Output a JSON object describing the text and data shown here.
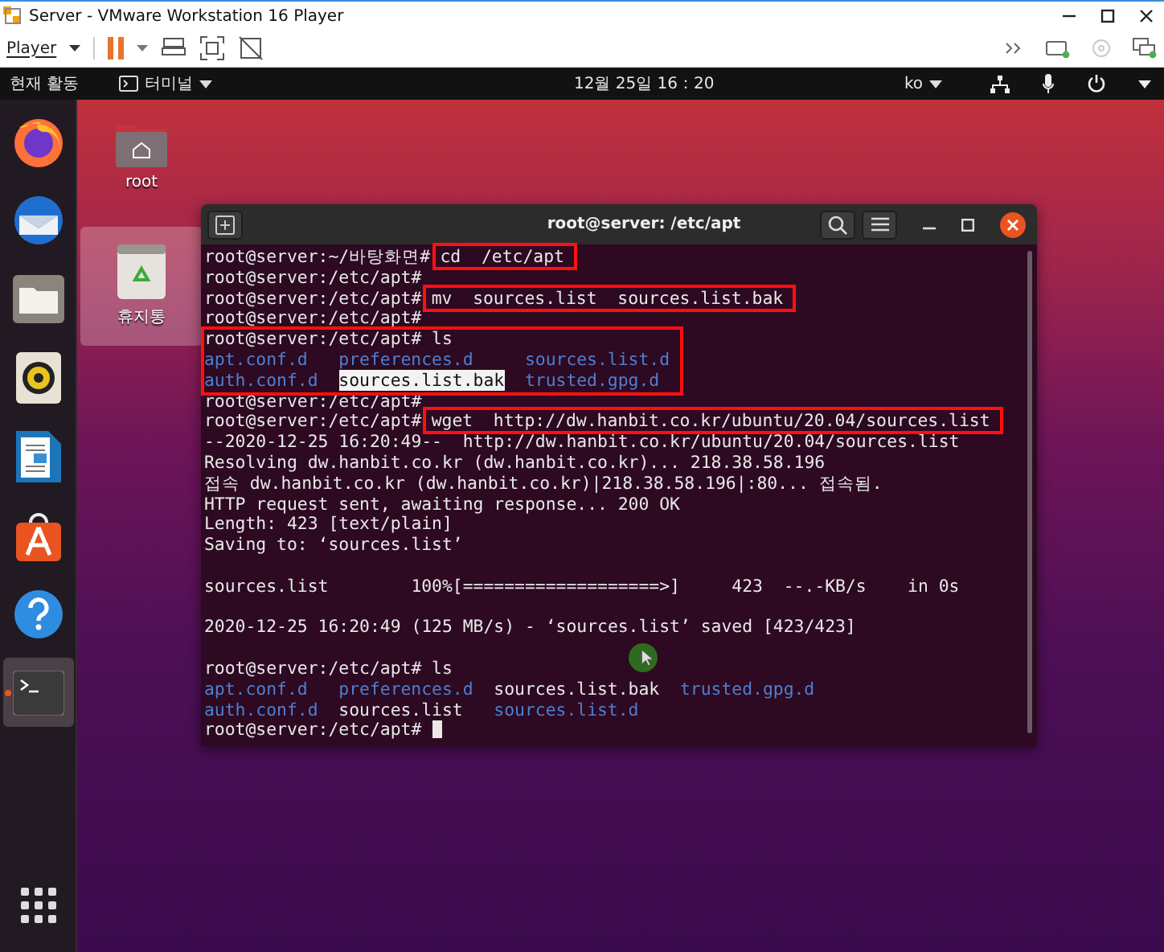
{
  "vmware": {
    "title": "Server - VMware Workstation 16 Player",
    "player_menu": "Player"
  },
  "topbar": {
    "activities": "현재 활동",
    "app_menu": "터미널",
    "clock": "12월 25일 16：20",
    "input_method": "ko"
  },
  "dock": [
    {
      "kind": "firefox",
      "running": false,
      "selected": false
    },
    {
      "kind": "mail",
      "running": false,
      "selected": false
    },
    {
      "kind": "files",
      "running": false,
      "selected": false
    },
    {
      "kind": "music",
      "running": false,
      "selected": false
    },
    {
      "kind": "writer",
      "running": false,
      "selected": false
    },
    {
      "kind": "software",
      "running": false,
      "selected": false
    },
    {
      "kind": "help",
      "running": false,
      "selected": false
    },
    {
      "kind": "terminal",
      "running": true,
      "selected": true
    }
  ],
  "desktop_icons": [
    {
      "kind": "home-folder",
      "label": "root",
      "selected": false
    },
    {
      "kind": "trash",
      "label": "휴지통",
      "selected": true
    }
  ],
  "terminal": {
    "title": "root@server: /etc/apt",
    "lines": [
      {
        "kind": "line",
        "segments": [
          {
            "kind": "prompt",
            "text": "root@server:~/바탕화면#",
            "annotated": false
          },
          {
            "kind": "command",
            "text": "cd  /etc/apt",
            "annotated": true
          }
        ]
      },
      {
        "kind": "line",
        "segments": [
          {
            "kind": "prompt",
            "text": "root@server:/etc/apt#",
            "annotated": false
          }
        ]
      },
      {
        "kind": "line",
        "segments": [
          {
            "kind": "prompt",
            "text": "root@server:/etc/apt#",
            "annotated": false
          },
          {
            "kind": "command",
            "text": "mv  sources.list  sources.list.bak",
            "annotated": true
          }
        ]
      },
      {
        "kind": "line",
        "segments": [
          {
            "kind": "prompt",
            "text": "root@server:/etc/apt#",
            "annotated": false
          }
        ]
      },
      {
        "kind": "annotated-group",
        "lines": [
          {
            "kind": "line",
            "segments": [
              {
                "kind": "prompt",
                "text": "root@server:/etc/apt#",
                "annotated": false
              },
              {
                "kind": "command",
                "text": "ls",
                "annotated": false
              }
            ]
          },
          {
            "kind": "listing",
            "rows": [
              [
                {
                  "text": "apt.conf.d",
                  "kind": "dir",
                  "selected": false
                },
                {
                  "text": "preferences.d",
                  "kind": "dir",
                  "selected": false
                },
                {
                  "text": "sources.list.d",
                  "kind": "dir",
                  "selected": false
                }
              ],
              [
                {
                  "text": "auth.conf.d",
                  "kind": "dir",
                  "selected": false
                },
                {
                  "text": "sources.list.bak",
                  "kind": "file",
                  "selected": true
                },
                {
                  "text": "trusted.gpg.d",
                  "kind": "dir",
                  "selected": false
                }
              ]
            ]
          }
        ]
      },
      {
        "kind": "line",
        "segments": [
          {
            "kind": "prompt",
            "text": "root@server:/etc/apt#",
            "annotated": false
          }
        ]
      },
      {
        "kind": "line",
        "segments": [
          {
            "kind": "prompt",
            "text": "root@server:/etc/apt#",
            "annotated": false
          },
          {
            "kind": "command",
            "text": "wget  http://dw.hanbit.co.kr/ubuntu/20.04/sources.list",
            "annotated": true
          }
        ]
      },
      {
        "kind": "line",
        "segments": [
          {
            "kind": "output",
            "text": "--2020-12-25 16:20:49--  http://dw.hanbit.co.kr/ubuntu/20.04/sources.list",
            "annotated": false
          }
        ]
      },
      {
        "kind": "line",
        "segments": [
          {
            "kind": "output",
            "text": "Resolving dw.hanbit.co.kr (dw.hanbit.co.kr)... 218.38.58.196",
            "annotated": false
          }
        ]
      },
      {
        "kind": "line",
        "segments": [
          {
            "kind": "output",
            "text": "접속 dw.hanbit.co.kr (dw.hanbit.co.kr)|218.38.58.196|:80... 접속됨.",
            "annotated": false
          }
        ]
      },
      {
        "kind": "line",
        "segments": [
          {
            "kind": "output",
            "text": "HTTP request sent, awaiting response... 200 OK",
            "annotated": false
          }
        ]
      },
      {
        "kind": "line",
        "segments": [
          {
            "kind": "output",
            "text": "Length: 423 [text/plain]",
            "annotated": false
          }
        ]
      },
      {
        "kind": "line",
        "segments": [
          {
            "kind": "output",
            "text": "Saving to: ‘sources.list’",
            "annotated": false
          }
        ]
      },
      {
        "kind": "blank"
      },
      {
        "kind": "line",
        "segments": [
          {
            "kind": "output",
            "text": "sources.list        100%[===================>]     423  --.-KB/s    in 0s",
            "annotated": false
          }
        ]
      },
      {
        "kind": "blank"
      },
      {
        "kind": "line",
        "segments": [
          {
            "kind": "output",
            "text": "2020-12-25 16:20:49 (125 MB/s) - ‘sources.list’ saved [423/423]",
            "annotated": false
          }
        ]
      },
      {
        "kind": "blank"
      },
      {
        "kind": "line",
        "segments": [
          {
            "kind": "prompt",
            "text": "root@server:/etc/apt#",
            "annotated": false
          },
          {
            "kind": "command",
            "text": "ls",
            "annotated": false
          }
        ]
      },
      {
        "kind": "listing",
        "rows": [
          [
            {
              "text": "apt.conf.d",
              "kind": "dir",
              "selected": false
            },
            {
              "text": "preferences.d",
              "kind": "dir",
              "selected": false
            },
            {
              "text": "sources.list.bak",
              "kind": "file",
              "selected": false
            },
            {
              "text": "trusted.gpg.d",
              "kind": "dir",
              "selected": false
            }
          ],
          [
            {
              "text": "auth.conf.d",
              "kind": "dir",
              "selected": false
            },
            {
              "text": "sources.list",
              "kind": "file",
              "selected": false
            },
            {
              "text": "sources.list.d",
              "kind": "dir",
              "selected": false
            }
          ]
        ]
      },
      {
        "kind": "line",
        "segments": [
          {
            "kind": "prompt",
            "text": "root@server:/etc/apt#",
            "annotated": false
          }
        ],
        "cursor": true
      }
    ]
  }
}
